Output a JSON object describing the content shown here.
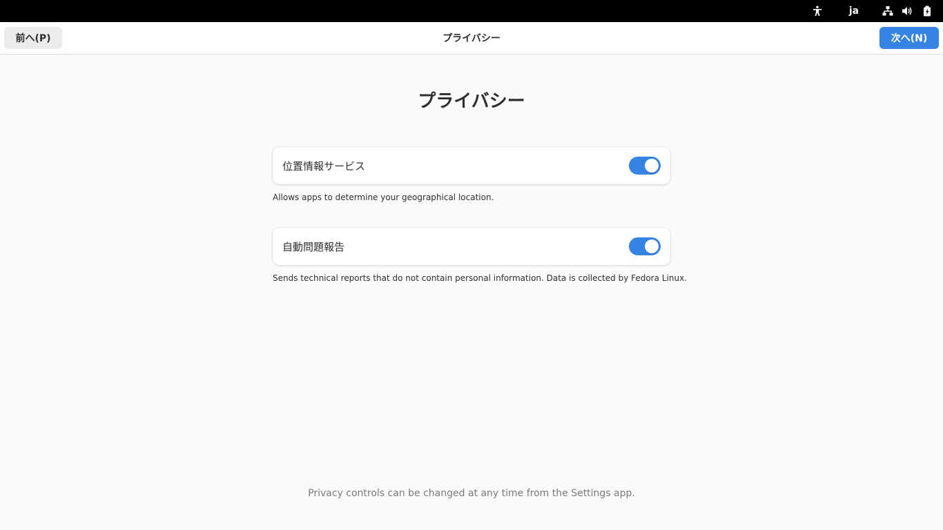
{
  "system_bar": {
    "language": "ja",
    "icons": [
      "accessibility-icon",
      "network-icon",
      "volume-icon",
      "battery-icon"
    ]
  },
  "header": {
    "prev_label": "前へ(P)",
    "title": "プライバシー",
    "next_label": "次へ(N)"
  },
  "main": {
    "heading": "プライバシー",
    "settings": [
      {
        "label": "位置情報サービス",
        "enabled": true,
        "description": "Allows apps to determine your geographical location."
      },
      {
        "label": "自動問題報告",
        "enabled": true,
        "description": "Sends technical reports that do not contain personal information. Data is collected by Fedora Linux."
      }
    ],
    "footer_note": "Privacy controls can be changed at any time from the Settings app."
  },
  "colors": {
    "accent": "#3584e4",
    "background": "#fafafa",
    "topbar": "#000000"
  }
}
